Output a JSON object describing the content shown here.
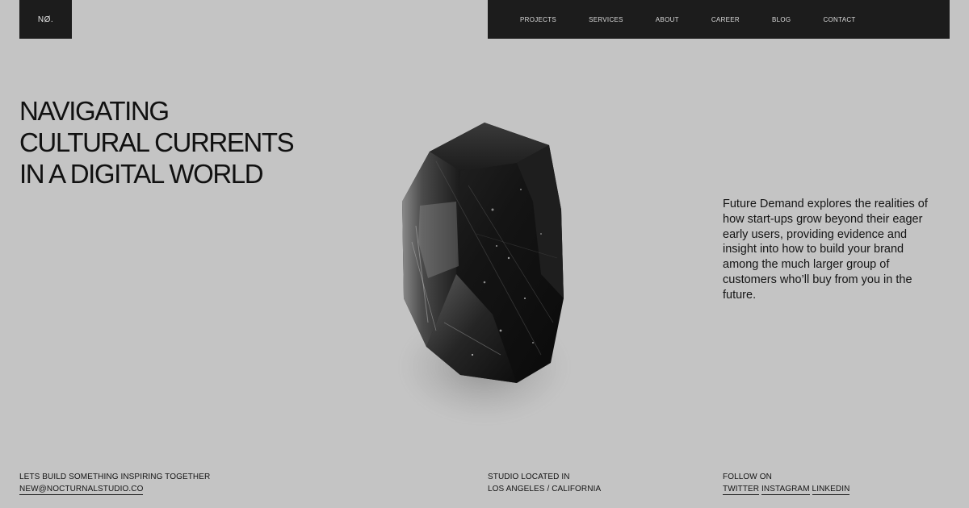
{
  "brand": {
    "logo": "NØ."
  },
  "nav": {
    "items": [
      "PROJECTS",
      "SERVICES",
      "ABOUT",
      "CAREER",
      "BLOG",
      "CONTACT"
    ]
  },
  "hero": {
    "headline_lines": [
      "NAVIGATING",
      "CULTURAL CURRENTS",
      "IN A DIGITAL WORLD"
    ],
    "description": "Future Demand explores the realities of how start-ups grow beyond their eager early users, providing evidence and insight into how to build your brand among the much larger group of customers who’ll buy from you in the future."
  },
  "footer": {
    "cta": "LETS BUILD SOMETHING INSPIRING TOGETHER",
    "email": "NEW@NOCTURNALSTUDIO.CO",
    "location_label": "STUDIO LOCATED IN",
    "location": "LOS ANGELES / CALIFORNIA",
    "follow_label": "FOLLOW ON",
    "social": [
      "TWITTER",
      "INSTAGRAM",
      "LINKEDIN"
    ]
  },
  "colors": {
    "background": "#c4c4c4",
    "dark": "#1c1c1c",
    "text": "#141414"
  }
}
